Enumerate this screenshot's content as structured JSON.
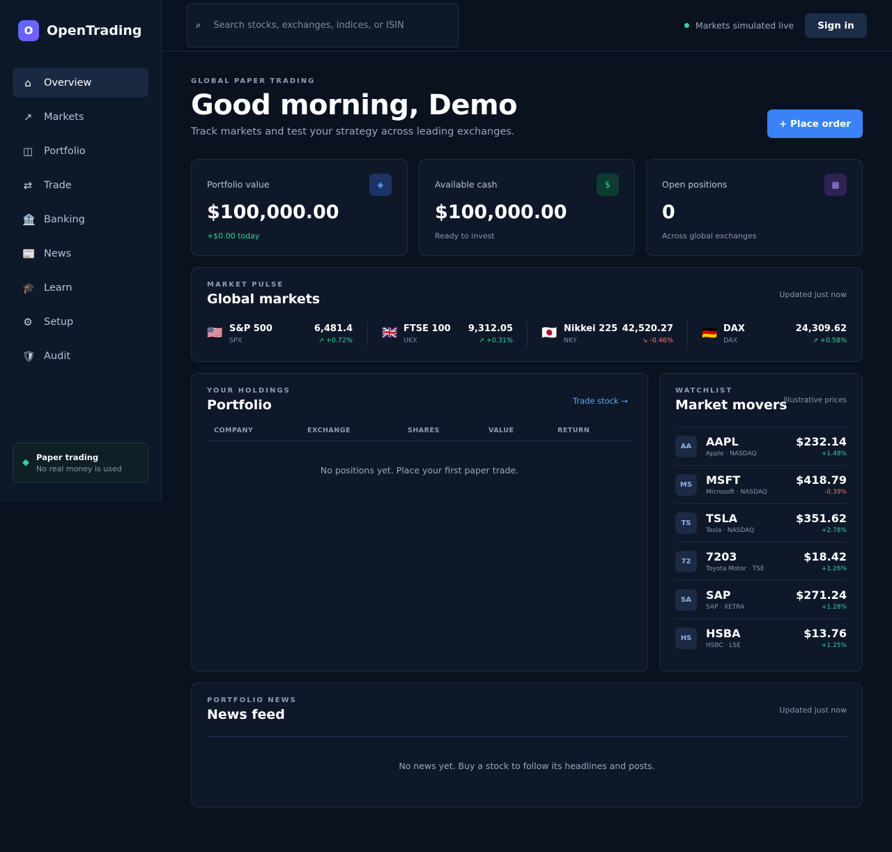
{
  "brand": {
    "logo_letter": "O",
    "name": "OpenTrading"
  },
  "nav": {
    "items": [
      {
        "label": "Overview",
        "icon": "home-icon",
        "glyph": "⌂"
      },
      {
        "label": "Markets",
        "icon": "trend-arrow-icon",
        "glyph": "↗"
      },
      {
        "label": "Portfolio",
        "icon": "columns-icon",
        "glyph": "◫"
      },
      {
        "label": "Trade",
        "icon": "swap-arrows-icon",
        "glyph": "⇄"
      },
      {
        "label": "Banking",
        "icon": "bank-icon",
        "glyph": "🏦"
      },
      {
        "label": "News",
        "icon": "newspaper-icon",
        "glyph": "📰"
      },
      {
        "label": "Learn",
        "icon": "graduation-cap-icon",
        "glyph": "🎓"
      },
      {
        "label": "Setup",
        "icon": "gear-icon",
        "glyph": "⚙"
      },
      {
        "label": "Audit",
        "icon": "shield-icon",
        "glyph": "🛡"
      }
    ],
    "active": "Overview"
  },
  "paper_trading": {
    "title": "Paper trading",
    "subtitle": "No real money is used"
  },
  "topbar": {
    "search_placeholder": "Search stocks, exchanges, indices, or ISIN",
    "search_value": "",
    "live_status": "Markets simulated live",
    "signin_label": "Sign in"
  },
  "hero": {
    "eyebrow": "GLOBAL PAPER TRADING",
    "title": "Good morning, Demo",
    "subtitle": "Track markets and test your strategy across leading exchanges.",
    "cta": "+ Place order"
  },
  "stats": {
    "portfolio": {
      "label": "Portfolio value",
      "value": "$100,000.00",
      "note": "+$0.00 today",
      "icon": "diamond-icon",
      "glyph": "◈",
      "icon_bg": "#1c3366",
      "icon_color": "#60a5fa"
    },
    "cash": {
      "label": "Available cash",
      "value": "$100,000.00",
      "note": "Ready to invest",
      "icon": "dollar-icon",
      "glyph": "$",
      "icon_bg": "#0f3b33",
      "icon_color": "#34d399"
    },
    "positions": {
      "label": "Open positions",
      "value": "0",
      "note": "Across global exchanges",
      "icon": "grid-icon",
      "glyph": "▦",
      "icon_bg": "#2e2352",
      "icon_color": "#a78bfa"
    }
  },
  "markets": {
    "eyebrow": "MARKET PULSE",
    "title": "Global markets",
    "updated": "Updated just now",
    "indices": [
      {
        "flag": "🇺🇸",
        "name": "S&P 500",
        "code": "SPX",
        "value": "6,481.4",
        "change": "↗ +0.72%",
        "dir": "up"
      },
      {
        "flag": "🇬🇧",
        "name": "FTSE 100",
        "code": "UKX",
        "value": "9,312.05",
        "change": "↗ +0.31%",
        "dir": "up"
      },
      {
        "flag": "🇯🇵",
        "name": "Nikkei 225",
        "code": "NKY",
        "value": "42,520.27",
        "change": "↘ -0.46%",
        "dir": "down"
      },
      {
        "flag": "🇩🇪",
        "name": "DAX",
        "code": "DAX",
        "value": "24,309.62",
        "change": "↗ +0.58%",
        "dir": "up"
      }
    ]
  },
  "holdings": {
    "eyebrow": "YOUR HOLDINGS",
    "title": "Portfolio",
    "link": "Trade stock →",
    "columns": [
      "COMPANY",
      "EXCHANGE",
      "SHARES",
      "VALUE",
      "RETURN"
    ],
    "empty": "No positions yet. Place your first paper trade."
  },
  "watchlist": {
    "eyebrow": "WATCHLIST",
    "title": "Market movers",
    "meta": "Illustrative prices",
    "items": [
      {
        "badge": "AA",
        "symbol": "AAPL",
        "name": "Apple · NASDAQ",
        "price": "$232.14",
        "change": "+1.48%",
        "dir": "up"
      },
      {
        "badge": "MS",
        "symbol": "MSFT",
        "name": "Microsoft · NASDAQ",
        "price": "$418.79",
        "change": "-0.39%",
        "dir": "down"
      },
      {
        "badge": "TS",
        "symbol": "TSLA",
        "name": "Tesla · NASDAQ",
        "price": "$351.62",
        "change": "+2.78%",
        "dir": "up"
      },
      {
        "badge": "72",
        "symbol": "7203",
        "name": "Toyota Motor · TSE",
        "price": "$18.42",
        "change": "+1.26%",
        "dir": "up"
      },
      {
        "badge": "SA",
        "symbol": "SAP",
        "name": "SAP · XETRA",
        "price": "$271.24",
        "change": "+1.28%",
        "dir": "up"
      },
      {
        "badge": "HS",
        "symbol": "HSBA",
        "name": "HSBC · LSE",
        "price": "$13.76",
        "change": "+1.25%",
        "dir": "up"
      }
    ]
  },
  "news": {
    "eyebrow": "PORTFOLIO NEWS",
    "title": "News feed",
    "updated": "Updated just now",
    "empty": "No news yet. Buy a stock to follow its headlines and posts."
  }
}
